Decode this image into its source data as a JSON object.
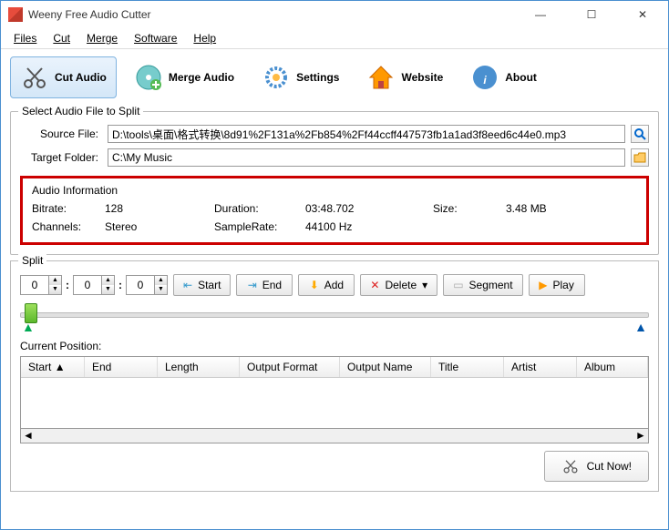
{
  "window": {
    "title": "Weeny Free Audio Cutter"
  },
  "menu": {
    "files": "Files",
    "cut": "Cut",
    "merge": "Merge",
    "software": "Software",
    "help": "Help"
  },
  "toolbar": {
    "cut": "Cut Audio",
    "merge": "Merge Audio",
    "settings": "Settings",
    "website": "Website",
    "about": "About"
  },
  "select_group": {
    "title": "Select Audio File to Split",
    "source_label": "Source File:",
    "source_value": "D:\\tools\\桌面\\格式转换\\8d91%2F131a%2Fb854%2Ff44ccff447573fb1a1ad3f8eed6c44e0.mp3",
    "target_label": "Target Folder:",
    "target_value": "C:\\My Music"
  },
  "audio_info": {
    "title": "Audio Information",
    "bitrate_label": "Bitrate:",
    "bitrate": "128",
    "channels_label": "Channels:",
    "channels": "Stereo",
    "duration_label": "Duration:",
    "duration": "03:48.702",
    "samplerate_label": "SampleRate:",
    "samplerate": "44100 Hz",
    "size_label": "Size:",
    "size": "3.48 MB"
  },
  "split": {
    "title": "Split",
    "h": "0",
    "m": "0",
    "s": "0",
    "start": "Start",
    "end": "End",
    "add": "Add",
    "delete": "Delete",
    "segment": "Segment",
    "play": "Play",
    "pos_label": "Current Position:"
  },
  "columns": {
    "start": "Start",
    "end": "End",
    "length": "Length",
    "format": "Output Format",
    "name": "Output Name",
    "title": "Title",
    "artist": "Artist",
    "album": "Album"
  },
  "cut_now": "Cut Now!"
}
